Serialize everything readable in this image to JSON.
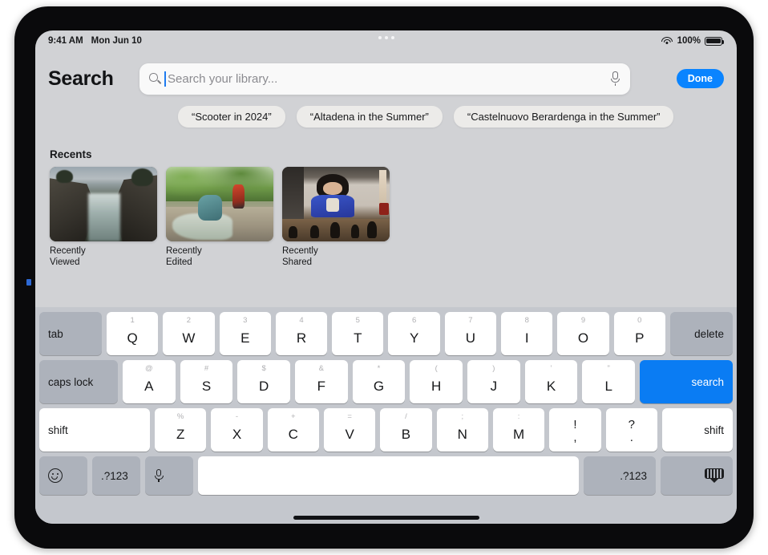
{
  "status_bar": {
    "time": "9:41 AM",
    "date": "Mon Jun 10",
    "wifi_icon": "wifi-icon",
    "battery_percent": "100%",
    "battery_icon": "battery-full-icon",
    "multitask_handle_icon": "three-dots-icon"
  },
  "header": {
    "title": "Search",
    "done_label": "Done"
  },
  "search": {
    "placeholder": "Search your library...",
    "value": "",
    "search_icon": "search-icon",
    "dictation_icon": "microphone-icon"
  },
  "suggestions": [
    {
      "label": "“Scooter in 2024”"
    },
    {
      "label": "“Altadena in the Summer”"
    },
    {
      "label": "“Castelnuovo Berardenga in the Summer”"
    }
  ],
  "recents": {
    "heading": "Recents",
    "items": [
      {
        "label": "Recently\nViewed",
        "line1": "Recently",
        "line2": "Viewed",
        "photo": "coastal-cliffs"
      },
      {
        "label": "Recently\nEdited",
        "line1": "Recently",
        "line2": "Edited",
        "photo": "stream-hikers"
      },
      {
        "label": "Recently\nShared",
        "line1": "Recently",
        "line2": "Shared",
        "photo": "girl-playing-chess"
      }
    ]
  },
  "keyboard": {
    "row1": {
      "tab": "tab",
      "keys": [
        {
          "main": "Q",
          "alt": "1"
        },
        {
          "main": "W",
          "alt": "2"
        },
        {
          "main": "E",
          "alt": "3"
        },
        {
          "main": "R",
          "alt": "4"
        },
        {
          "main": "T",
          "alt": "5"
        },
        {
          "main": "Y",
          "alt": "6"
        },
        {
          "main": "U",
          "alt": "7"
        },
        {
          "main": "I",
          "alt": "8"
        },
        {
          "main": "O",
          "alt": "9"
        },
        {
          "main": "P",
          "alt": "0"
        }
      ],
      "delete": "delete"
    },
    "row2": {
      "caps_lock": "caps lock",
      "keys": [
        {
          "main": "A",
          "alt": "@"
        },
        {
          "main": "S",
          "alt": "#"
        },
        {
          "main": "D",
          "alt": "$"
        },
        {
          "main": "F",
          "alt": "&"
        },
        {
          "main": "G",
          "alt": "*"
        },
        {
          "main": "H",
          "alt": "("
        },
        {
          "main": "J",
          "alt": ")"
        },
        {
          "main": "K",
          "alt": "’"
        },
        {
          "main": "L",
          "alt": "”"
        }
      ],
      "search": "search"
    },
    "row3": {
      "shift_left": "shift",
      "keys": [
        {
          "main": "Z",
          "alt": "%"
        },
        {
          "main": "X",
          "alt": "-"
        },
        {
          "main": "C",
          "alt": "+"
        },
        {
          "main": "V",
          "alt": "="
        },
        {
          "main": "B",
          "alt": "/"
        },
        {
          "main": "N",
          "alt": ";"
        },
        {
          "main": "M",
          "alt": ":"
        }
      ],
      "punct1": {
        "top": "!",
        "bot": ","
      },
      "punct2": {
        "top": "?",
        "bot": "."
      },
      "shift_right": "shift"
    },
    "row4": {
      "emoji_icon": "emoji-icon",
      "numbers_left": ".?123",
      "mic_icon": "microphone-icon",
      "space": "",
      "numbers_right": ".?123",
      "dismiss_icon": "dismiss-keyboard-icon"
    }
  },
  "colors": {
    "accent_blue": "#0a84ff",
    "search_key_blue": "#0a7cf3",
    "keyboard_bg": "#c4c7cd",
    "key_white": "#ffffff",
    "key_dark": "#adb2bb"
  }
}
